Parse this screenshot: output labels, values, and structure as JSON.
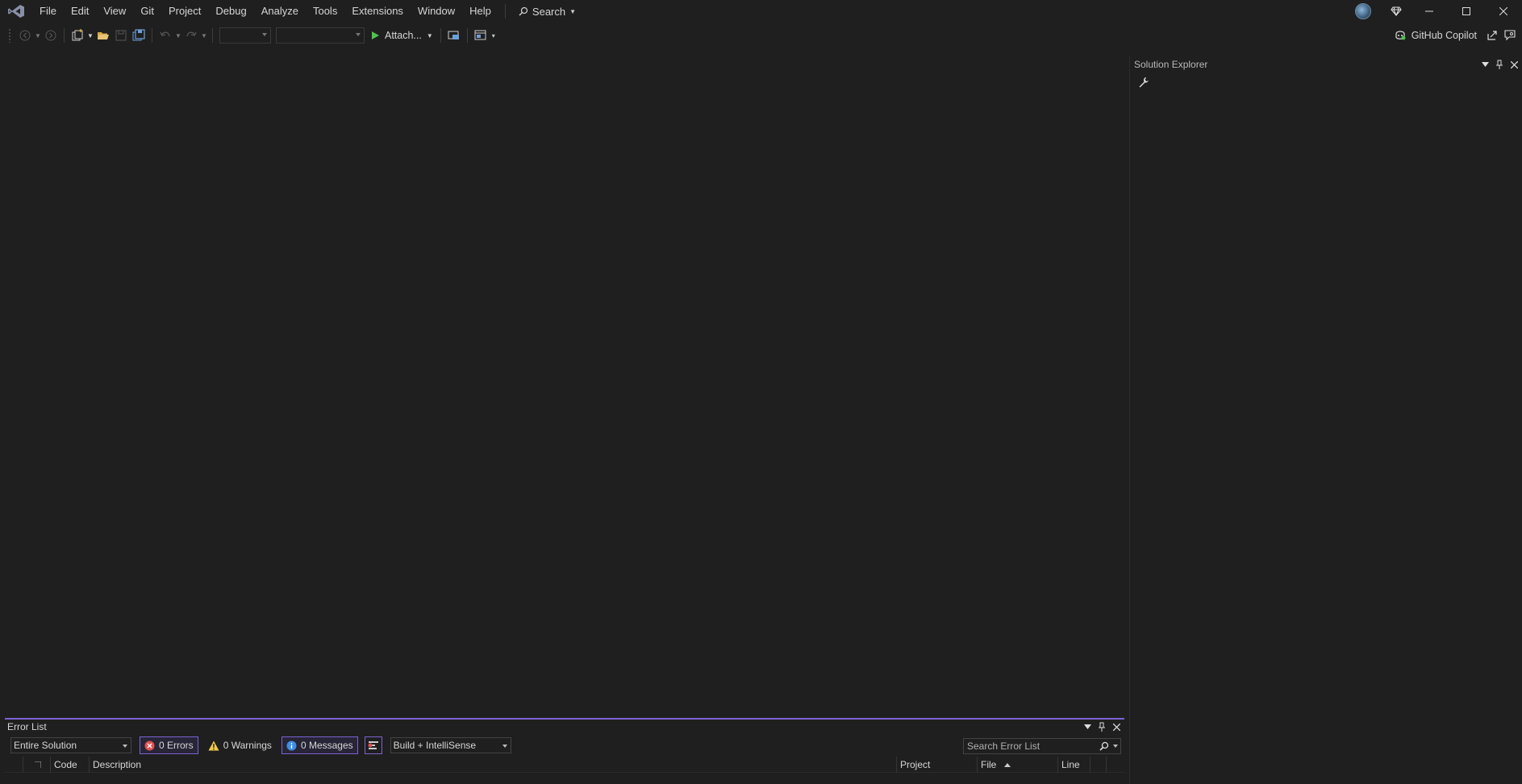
{
  "menu": {
    "items": [
      "File",
      "Edit",
      "View",
      "Git",
      "Project",
      "Debug",
      "Analyze",
      "Tools",
      "Extensions",
      "Window",
      "Help"
    ],
    "search_label": "Search"
  },
  "toolbar": {
    "attach_label": "Attach...",
    "copilot_label": "GitHub Copilot"
  },
  "solution_explorer": {
    "title": "Solution Explorer"
  },
  "error_list": {
    "title": "Error List",
    "scope": "Entire Solution",
    "errors_label": "0 Errors",
    "warnings_label": "0 Warnings",
    "messages_label": "0 Messages",
    "build_filter": "Build + IntelliSense",
    "search_placeholder": "Search Error List",
    "columns": {
      "code": "Code",
      "description": "Description",
      "project": "Project",
      "file": "File",
      "line": "Line"
    }
  },
  "colors": {
    "background": "#1f1f1f",
    "accent": "#7d62d6",
    "text": "#d6d6d6"
  }
}
